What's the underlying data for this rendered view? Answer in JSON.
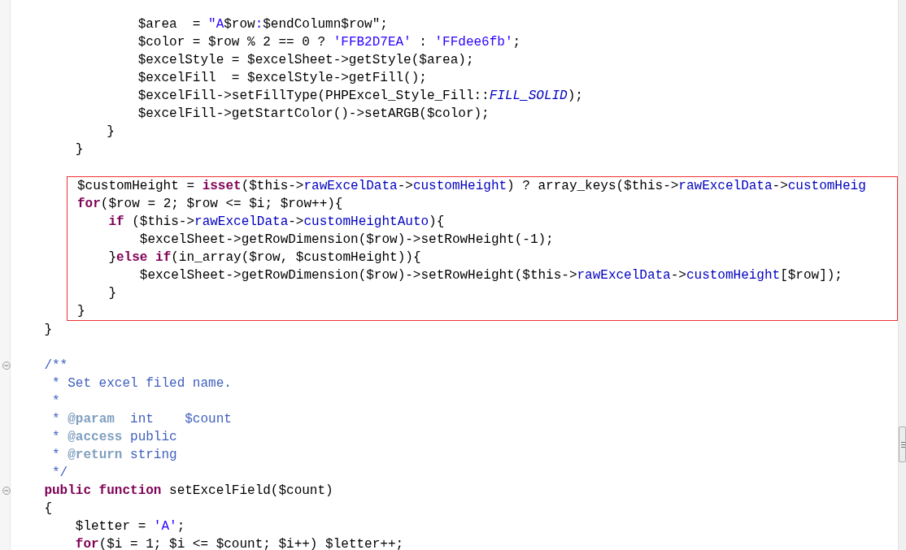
{
  "editor": {
    "blocks": [
      {
        "kind": "plain",
        "lines": [
          {
            "kind": "blank"
          },
          {
            "kind": "code",
            "tokens": [
              {
                "kind": "plain",
                "text": "                $area  = "
              },
              {
                "kind": "string",
                "text": "\"A"
              },
              {
                "kind": "plain",
                "text": "$row"
              },
              {
                "kind": "string",
                "text": ":"
              },
              {
                "kind": "plain",
                "text": "$endColumn$row\";"
              }
            ]
          },
          {
            "kind": "code",
            "tokens": [
              {
                "kind": "plain",
                "text": "                $color = $row % 2 == 0 ? "
              },
              {
                "kind": "string",
                "text": "'FFB2D7EA'"
              },
              {
                "kind": "plain",
                "text": " : "
              },
              {
                "kind": "string",
                "text": "'FFdee6fb'"
              },
              {
                "kind": "plain",
                "text": ";"
              }
            ]
          },
          {
            "kind": "code",
            "tokens": [
              {
                "kind": "plain",
                "text": "                $excelStyle = $excelSheet->getStyle($area);"
              }
            ]
          },
          {
            "kind": "code",
            "tokens": [
              {
                "kind": "plain",
                "text": "                $excelFill  = $excelStyle->getFill();"
              }
            ]
          },
          {
            "kind": "code",
            "tokens": [
              {
                "kind": "plain",
                "text": "                $excelFill->setFillType(PHPExcel_Style_Fill::"
              },
              {
                "kind": "constant",
                "text": "FILL_SOLID"
              },
              {
                "kind": "plain",
                "text": ");"
              }
            ]
          },
          {
            "kind": "code",
            "tokens": [
              {
                "kind": "plain",
                "text": "                $excelFill->getStartColor()->setARGB($color);"
              }
            ]
          },
          {
            "kind": "code",
            "tokens": [
              {
                "kind": "plain",
                "text": "            }"
              }
            ]
          },
          {
            "kind": "code",
            "tokens": [
              {
                "kind": "plain",
                "text": "        }"
              }
            ]
          },
          {
            "kind": "blank"
          }
        ]
      },
      {
        "kind": "highlight",
        "lines": [
          {
            "kind": "code",
            "tokens": [
              {
                "kind": "plain",
                "text": "$customHeight = "
              },
              {
                "kind": "keyword",
                "text": "isset"
              },
              {
                "kind": "plain",
                "text": "($this->"
              },
              {
                "kind": "field",
                "text": "rawExcelData"
              },
              {
                "kind": "plain",
                "text": "->"
              },
              {
                "kind": "field",
                "text": "customHeight"
              },
              {
                "kind": "plain",
                "text": ") ? array_keys($this->"
              },
              {
                "kind": "field",
                "text": "rawExcelData"
              },
              {
                "kind": "plain",
                "text": "->"
              },
              {
                "kind": "field",
                "text": "customHeig"
              }
            ]
          },
          {
            "kind": "code",
            "tokens": [
              {
                "kind": "keyword",
                "text": "for"
              },
              {
                "kind": "plain",
                "text": "($row = 2; $row <= $i; $row++){"
              }
            ]
          },
          {
            "kind": "code",
            "tokens": [
              {
                "kind": "keyword",
                "text": "    if"
              },
              {
                "kind": "plain",
                "text": " ($this->"
              },
              {
                "kind": "field",
                "text": "rawExcelData"
              },
              {
                "kind": "plain",
                "text": "->"
              },
              {
                "kind": "field",
                "text": "customHeightAuto"
              },
              {
                "kind": "plain",
                "text": "){"
              }
            ]
          },
          {
            "kind": "code",
            "tokens": [
              {
                "kind": "plain",
                "text": "        $excelSheet->getRowDimension($row)->setRowHeight(-1);"
              }
            ]
          },
          {
            "kind": "code",
            "tokens": [
              {
                "kind": "plain",
                "text": "    }"
              },
              {
                "kind": "keyword",
                "text": "else if"
              },
              {
                "kind": "plain",
                "text": "(in_array($row, $customHeight)){"
              }
            ]
          },
          {
            "kind": "code",
            "tokens": [
              {
                "kind": "plain",
                "text": "        $excelSheet->getRowDimension($row)->setRowHeight($this->"
              },
              {
                "kind": "field",
                "text": "rawExcelData"
              },
              {
                "kind": "plain",
                "text": "->"
              },
              {
                "kind": "field",
                "text": "customHeight"
              },
              {
                "kind": "plain",
                "text": "[$row]);"
              }
            ]
          },
          {
            "kind": "code",
            "tokens": [
              {
                "kind": "plain",
                "text": "    }"
              }
            ]
          },
          {
            "kind": "code",
            "tokens": [
              {
                "kind": "plain",
                "text": "}"
              }
            ]
          }
        ]
      },
      {
        "kind": "plain",
        "lines": [
          {
            "kind": "code",
            "tokens": [
              {
                "kind": "plain",
                "text": "    }"
              }
            ]
          },
          {
            "kind": "blank"
          },
          {
            "kind": "fold-start",
            "expanded": true,
            "tokens": [
              {
                "kind": "comment",
                "text": "    /**"
              }
            ]
          },
          {
            "kind": "code",
            "tokens": [
              {
                "kind": "comment",
                "text": "     * Set excel filed name."
              }
            ]
          },
          {
            "kind": "code",
            "tokens": [
              {
                "kind": "comment",
                "text": "     *"
              }
            ]
          },
          {
            "kind": "code",
            "tokens": [
              {
                "kind": "comment",
                "text": "     * "
              },
              {
                "kind": "doctag",
                "text": "@param"
              },
              {
                "kind": "comment",
                "text": "  int    $count"
              }
            ]
          },
          {
            "kind": "code",
            "tokens": [
              {
                "kind": "comment",
                "text": "     * "
              },
              {
                "kind": "doctag",
                "text": "@access"
              },
              {
                "kind": "comment",
                "text": " public"
              }
            ]
          },
          {
            "kind": "code",
            "tokens": [
              {
                "kind": "comment",
                "text": "     * "
              },
              {
                "kind": "doctag",
                "text": "@return"
              },
              {
                "kind": "comment",
                "text": " string"
              }
            ]
          },
          {
            "kind": "code",
            "tokens": [
              {
                "kind": "comment",
                "text": "     */"
              }
            ]
          },
          {
            "kind": "fold-start",
            "expanded": true,
            "tokens": [
              {
                "kind": "keyword",
                "text": "    public function"
              },
              {
                "kind": "plain",
                "text": " setExcelField($count)"
              }
            ]
          },
          {
            "kind": "code",
            "tokens": [
              {
                "kind": "plain",
                "text": "    {"
              }
            ]
          },
          {
            "kind": "code",
            "tokens": [
              {
                "kind": "plain",
                "text": "        $letter = "
              },
              {
                "kind": "string",
                "text": "'A'"
              },
              {
                "kind": "plain",
                "text": ";"
              }
            ]
          },
          {
            "kind": "code",
            "tokens": [
              {
                "kind": "keyword",
                "text": "        for"
              },
              {
                "kind": "plain",
                "text": "($i = 1; $i <= $count; $i++) $letter++;"
              }
            ]
          }
        ]
      }
    ]
  }
}
